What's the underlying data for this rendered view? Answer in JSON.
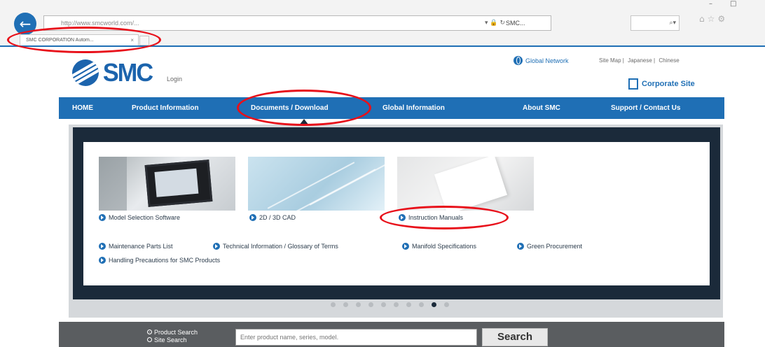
{
  "browser": {
    "address_url": "http://www.smcworld.com/...",
    "address_tools": "▾ 🔒 ↻",
    "address_page_title": "SMC...",
    "search_glyphs": "⌕▾",
    "toolbar_icons": "⌂☆⚙",
    "window_controls": [
      "–",
      "□"
    ],
    "tab_label": "SMC CORPORATION Autom...",
    "tab_close": "×"
  },
  "header": {
    "logo_text": "SMC",
    "login_label": "Login",
    "global_network_label": "Global Network",
    "top_links": [
      "Site Map |",
      "Japanese |",
      "Chinese"
    ],
    "corporate_site_label": "Corporate Site"
  },
  "nav": {
    "items": [
      "HOME",
      "Product Information",
      "Documents / Download",
      "Global Information",
      "About SMC",
      "Support / Contact Us"
    ]
  },
  "panel": {
    "featured_links": [
      "Model Selection Software",
      "2D / 3D CAD",
      "Instruction Manuals"
    ],
    "other_links": [
      "Maintenance Parts List",
      "Technical Information / Glossary of Terms",
      "Manifold Specifications",
      "Green Procurement",
      "Handling Precautions for SMC Products"
    ]
  },
  "pager": {
    "total": 10,
    "active_index": 8
  },
  "search": {
    "radio_product": "Product Search",
    "radio_site": "Site Search",
    "placeholder": "Enter product name, series, model.",
    "button_label": "Search"
  },
  "annotation_color": "#e8101a",
  "brand_color": "#1f6fb5"
}
